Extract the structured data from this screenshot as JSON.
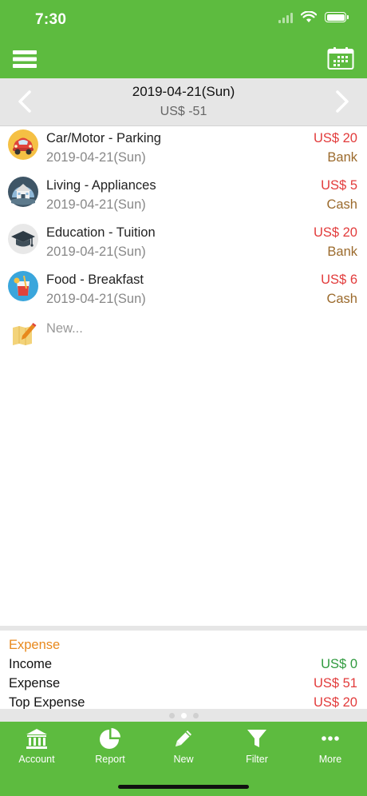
{
  "status": {
    "time": "7:30"
  },
  "date_nav": {
    "title": "2019-04-21(Sun)",
    "total": "US$ -51"
  },
  "transactions": [
    {
      "title": "Car/Motor - Parking",
      "date": "2019-04-21(Sun)",
      "amount": "US$ 20",
      "account": "Bank",
      "icon": "car-icon"
    },
    {
      "title": "Living - Appliances",
      "date": "2019-04-21(Sun)",
      "amount": "US$ 5",
      "account": "Cash",
      "icon": "house-icon"
    },
    {
      "title": "Education - Tuition",
      "date": "2019-04-21(Sun)",
      "amount": "US$ 20",
      "account": "Bank",
      "icon": "graduation-cap-icon"
    },
    {
      "title": "Food - Breakfast",
      "date": "2019-04-21(Sun)",
      "amount": "US$ 6",
      "account": "Cash",
      "icon": "drink-icon"
    }
  ],
  "new_entry": {
    "label": "New..."
  },
  "summary": {
    "title": "Expense",
    "income_label": "Income",
    "income_value": "US$ 0",
    "expense_label": "Expense",
    "expense_value": "US$ 51",
    "top_label": "Top Expense",
    "top_value": "US$ 20"
  },
  "tabs": [
    {
      "label": "Account",
      "icon": "bank-icon"
    },
    {
      "label": "Report",
      "icon": "pie-chart-icon"
    },
    {
      "label": "New",
      "icon": "pencil-icon"
    },
    {
      "label": "Filter",
      "icon": "filter-icon"
    },
    {
      "label": "More",
      "icon": "more-icon"
    }
  ],
  "colors": {
    "brand_green": "#5dbb3f",
    "amount_red": "#e23b3b",
    "account_brown": "#9b6a2c",
    "summary_orange": "#e8891d",
    "income_green": "#2f9a3e"
  }
}
